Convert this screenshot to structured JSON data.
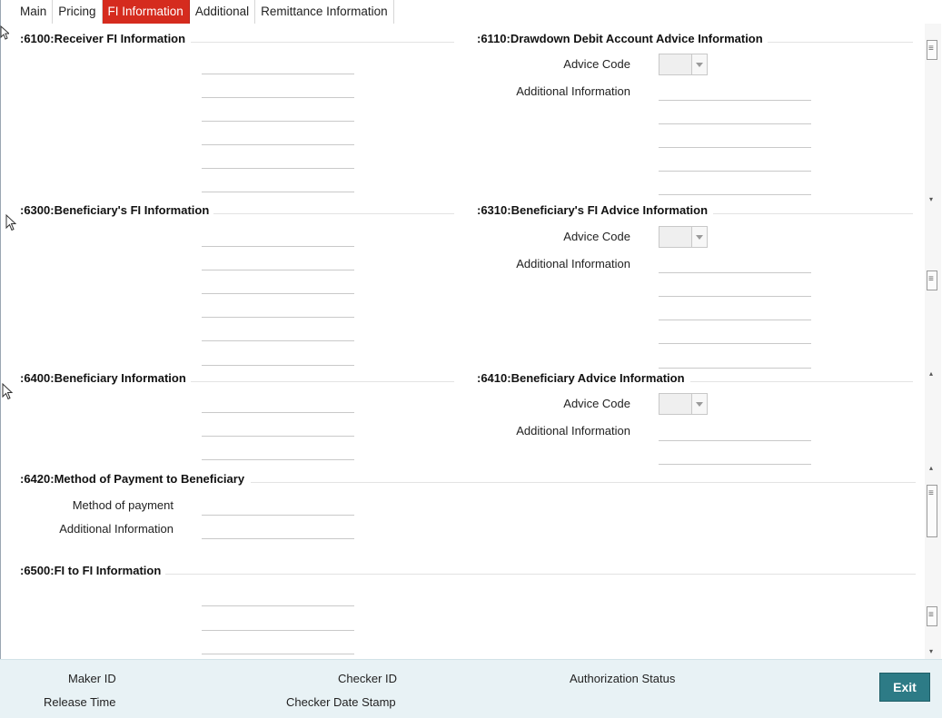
{
  "tabs": [
    {
      "label": "Main",
      "active": false
    },
    {
      "label": "Pricing",
      "active": false
    },
    {
      "label": "FI Information",
      "active": true
    },
    {
      "label": "Additional",
      "active": false
    },
    {
      "label": "Remittance Information",
      "active": false
    }
  ],
  "sections": {
    "s6100": {
      "title": ":6100:Receiver FI Information"
    },
    "s6110": {
      "title": ":6110:Drawdown Debit Account Advice Information",
      "advice_code_label": "Advice Code",
      "additional_info_label": "Additional Information"
    },
    "s6300": {
      "title": ":6300:Beneficiary's FI Information"
    },
    "s6310": {
      "title": ":6310:Beneficiary's FI Advice Information",
      "advice_code_label": "Advice Code",
      "additional_info_label": "Additional Information"
    },
    "s6400": {
      "title": ":6400:Beneficiary Information"
    },
    "s6410": {
      "title": ":6410:Beneficiary Advice Information",
      "advice_code_label": "Advice Code",
      "additional_info_label": "Additional Information"
    },
    "s6420": {
      "title": ":6420:Method of Payment to Beneficiary",
      "method_label": "Method of payment",
      "additional_info_label": "Additional Information"
    },
    "s6500": {
      "title": ":6500:FI to FI Information"
    }
  },
  "footer": {
    "maker_id_label": "Maker ID",
    "release_time_label": "Release Time",
    "checker_id_label": "Checker ID",
    "checker_date_label": "Checker Date Stamp",
    "auth_status_label": "Authorization Status",
    "exit_label": "Exit"
  },
  "colors": {
    "active_tab": "#d52b1e",
    "footer_bg": "#e8f2f5",
    "exit_button": "#2d7b86"
  }
}
